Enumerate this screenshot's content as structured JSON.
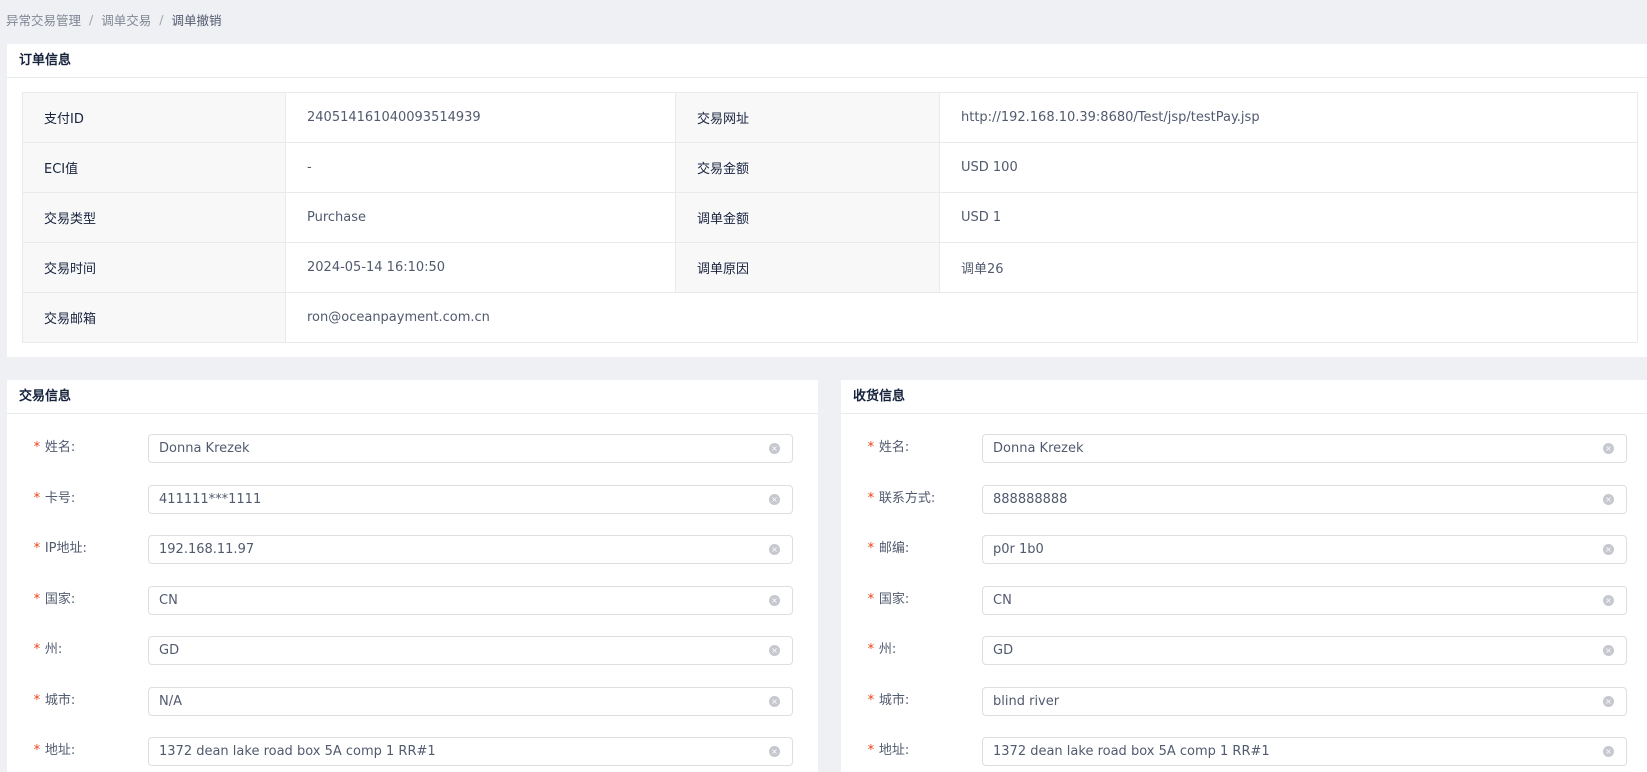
{
  "breadcrumb": [
    "异常交易管理",
    "调单交易",
    "调单撤销"
  ],
  "order": {
    "title": "订单信息",
    "rows": [
      {
        "l1": "支付ID",
        "v1": "240514161040093514939",
        "l2": "交易网址",
        "v2": "http://192.168.10.39:8680/Test/jsp/testPay.jsp"
      },
      {
        "l1": "ECI值",
        "v1": "-",
        "l2": "交易金额",
        "v2": "USD 100"
      },
      {
        "l1": "交易类型",
        "v1": "Purchase",
        "l2": "调单金额",
        "v2": "USD 1"
      },
      {
        "l1": "交易时间",
        "v1": "2024-05-14 16:10:50",
        "l2": "调单原因",
        "v2": "调单26"
      },
      {
        "l1": "交易邮箱",
        "v1": "ron@oceanpayment.com.cn"
      }
    ]
  },
  "trade": {
    "title": "交易信息",
    "fields": [
      {
        "label": "姓名:",
        "value": "Donna Krezek"
      },
      {
        "label": "卡号:",
        "value": "411111***1111"
      },
      {
        "label": "IP地址:",
        "value": "192.168.11.97"
      },
      {
        "label": "国家:",
        "value": "CN"
      },
      {
        "label": "州:",
        "value": "GD"
      },
      {
        "label": "城市:",
        "value": "N/A"
      },
      {
        "label": "地址:",
        "value": "1372 dean lake road box 5A comp 1 RR#1"
      }
    ]
  },
  "shipping": {
    "title": "收货信息",
    "fields": [
      {
        "label": "姓名:",
        "value": "Donna Krezek"
      },
      {
        "label": "联系方式:",
        "value": "888888888"
      },
      {
        "label": "邮编:",
        "value": "p0r 1b0"
      },
      {
        "label": "国家:",
        "value": "CN"
      },
      {
        "label": "州:",
        "value": "GD"
      },
      {
        "label": "城市:",
        "value": "blind river"
      },
      {
        "label": "地址:",
        "value": "1372 dean lake road box 5A comp 1 RR#1"
      }
    ]
  },
  "required_mark": "*",
  "clear_icon": "×",
  "colors": {
    "required": "#ed4014",
    "label_bg": "#f8f8f9",
    "page_bg": "#eef0f3"
  }
}
